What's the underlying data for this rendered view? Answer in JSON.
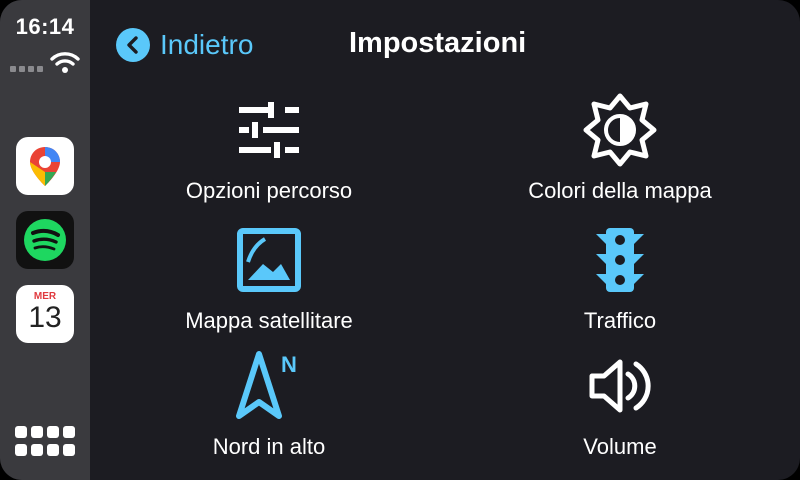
{
  "status": {
    "time": "16:14"
  },
  "dock": {
    "apps": [
      {
        "name": "Maps"
      },
      {
        "name": "Spotify"
      },
      {
        "name": "Calendar",
        "day_label": "MER",
        "date_number": "13"
      }
    ]
  },
  "header": {
    "back_label": "Indietro",
    "title": "Impostazioni"
  },
  "settings": [
    {
      "label": "Opzioni percorso",
      "icon": "sliders-icon",
      "color": "#ffffff"
    },
    {
      "label": "Colori della mappa",
      "icon": "sun-half-icon",
      "color": "#ffffff"
    },
    {
      "label": "Mappa satellitare",
      "icon": "satellite-image-icon",
      "color": "#5ac8fa"
    },
    {
      "label": "Traffico",
      "icon": "traffic-light-icon",
      "color": "#5ac8fa"
    },
    {
      "label": "Nord in alto",
      "icon": "north-arrow-icon",
      "color": "#5ac8fa",
      "icon_letter": "N"
    },
    {
      "label": "Volume",
      "icon": "speaker-icon",
      "color": "#ffffff"
    }
  ],
  "colors": {
    "accent": "#5ac8fa",
    "background": "#1c1c22",
    "sidebar": "#3a3a3e"
  }
}
